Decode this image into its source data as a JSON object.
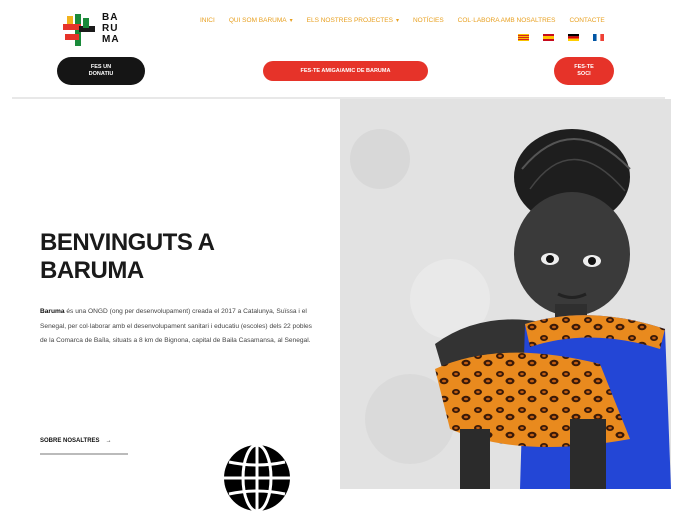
{
  "logo": {
    "text": "BA RU MA",
    "lines": [
      "BA",
      "RU",
      "MA"
    ]
  },
  "nav": {
    "items": [
      {
        "label": "INICI",
        "dropdown": false
      },
      {
        "label": "QUI SOM BARUMA",
        "dropdown": true
      },
      {
        "label": "ELS NOSTRES PROJECTES",
        "dropdown": true
      },
      {
        "label": "NOTÍCIES",
        "dropdown": false
      },
      {
        "label": "COL·LABORA AMB NOSALTRES",
        "dropdown": false
      },
      {
        "label": "CONTACTE",
        "dropdown": false
      }
    ],
    "flags": [
      "es-ca",
      "es",
      "de",
      "fr"
    ]
  },
  "buttons": {
    "black": "FES UN DONATIU",
    "red_wide": "FES-TE AMIGA/AMIC DE BARUMA",
    "red_small": "FES-TE SOCI"
  },
  "hero": {
    "title_line1": "BENVINGUTS A",
    "title_line2": "BARUMA",
    "text_bold": "Baruma",
    "text_rest": " és una ONGD (ong per desenvolupament) creada el 2017 a Catalunya, Suïssa i el Senegal, per col·laborar amb el desenvolupament sanitari i educatiu (escoles) dels 22 pobles de la Comarca de Baïla, situats a 8 km de Bignona, capital de Baila Casamansa, al Senegal.",
    "more_link": "SOBRE NOSALTRES"
  },
  "colors": {
    "accent_red": "#e63329",
    "accent_orange": "#e8a020",
    "dark": "#151515"
  }
}
